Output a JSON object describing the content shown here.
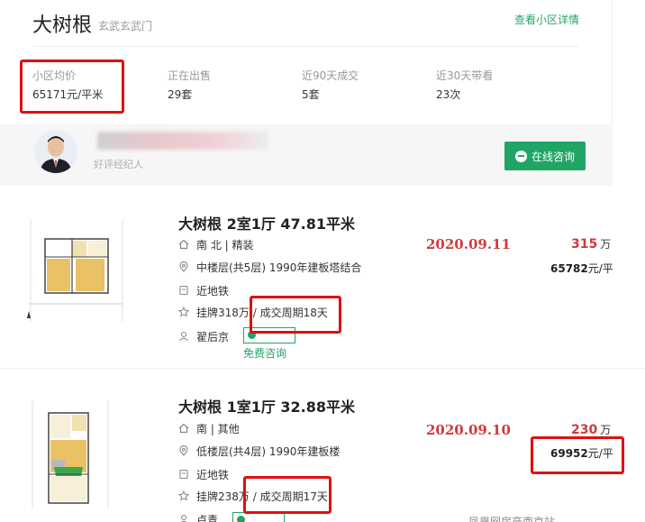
{
  "community": {
    "name": "大树根",
    "area": "玄武玄武门",
    "detail_link": "查看小区详情"
  },
  "stats": [
    {
      "label": "小区均价",
      "value": "65171元/平米"
    },
    {
      "label": "正在出售",
      "value": "29套"
    },
    {
      "label": "近90天成交",
      "value": "5套"
    },
    {
      "label": "近30天带看",
      "value": "23次"
    }
  ],
  "agent": {
    "role": "好评经纪人",
    "consult_button": "在线咨询"
  },
  "listings": [
    {
      "title": "大树根 2室1厅 47.81平米",
      "orientation": "南 北 | 精装",
      "floor": "中楼层(共5层) 1990年建板塔结合",
      "subway": "近地铁",
      "listing_cycle": "挂牌318万 / 成交周期18天",
      "agent": "翟后京",
      "free_consult": "免费咨询",
      "date": "2020.09.11",
      "price": "315",
      "price_unit": "万",
      "unit_price": "65782",
      "unit_price_suffix": "元/平"
    },
    {
      "title": "大树根 1室1厅 32.88平米",
      "orientation": "南 | 其他",
      "floor": "低楼层(共4层) 1990年建板楼",
      "subway": "近地铁",
      "listing_cycle": "挂牌238万 / 成交周期17天",
      "agent": "卢青",
      "date": "2020.09.10",
      "price": "230",
      "price_unit": "万",
      "unit_price": "69952",
      "unit_price_suffix": "元/平"
    }
  ],
  "watermark": "凤凰网房产南京站"
}
